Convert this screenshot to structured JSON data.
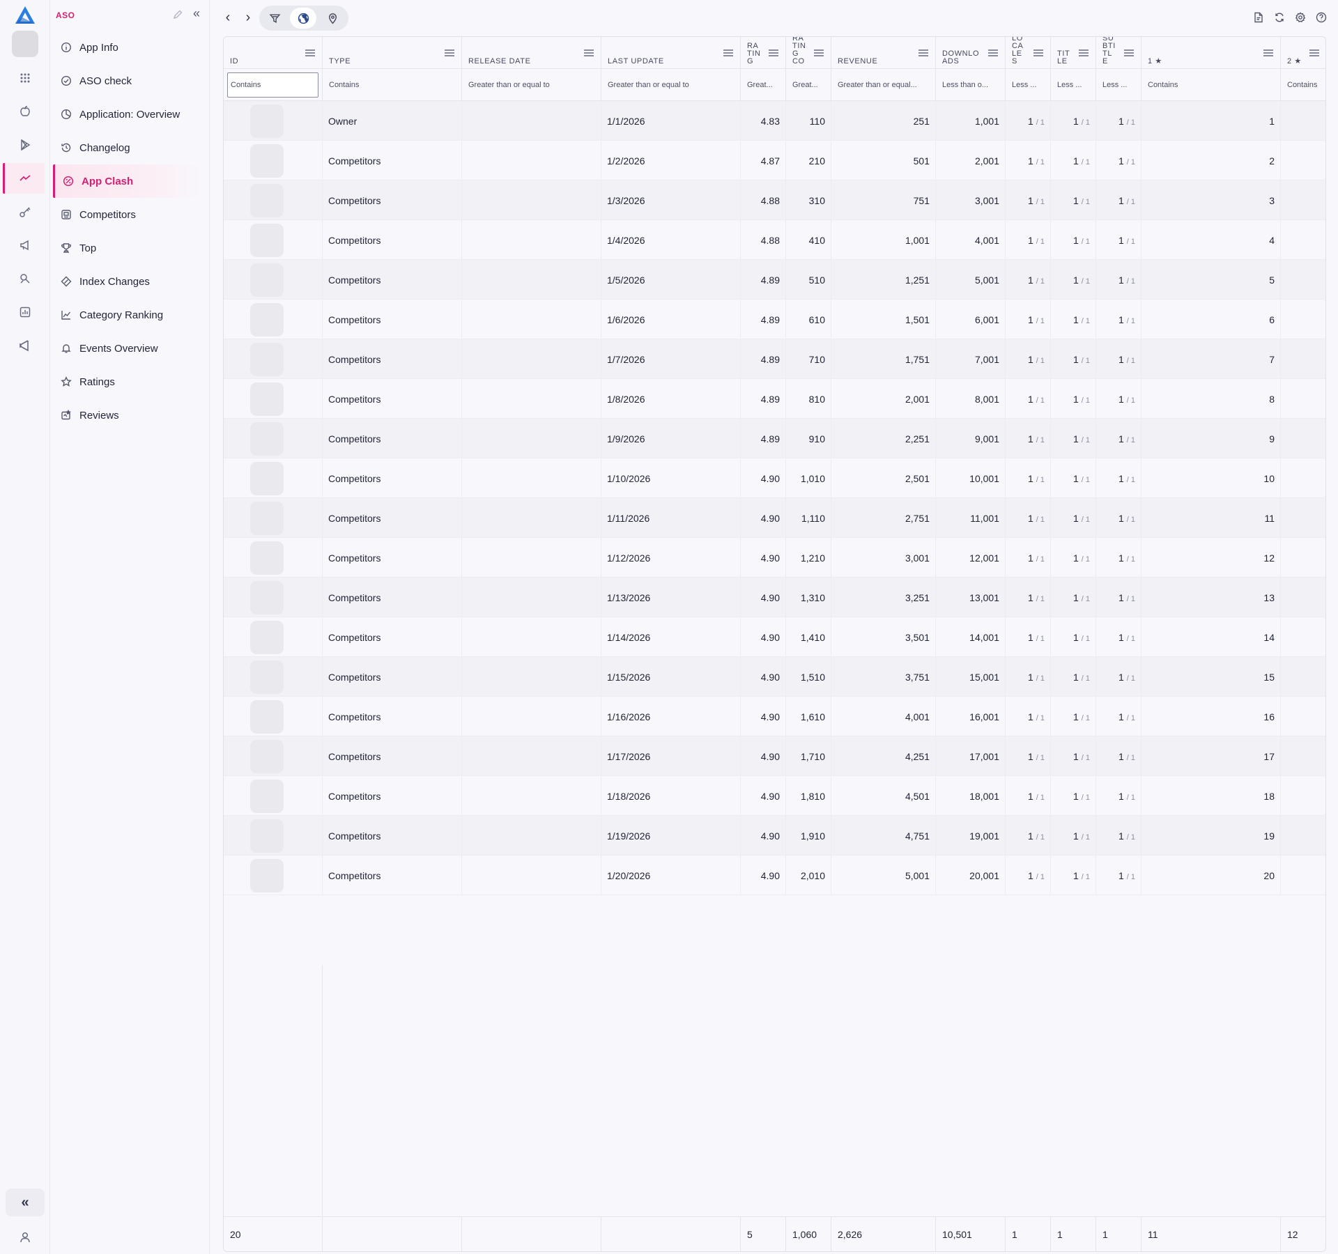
{
  "app": {
    "section_title": "ASO",
    "brand_color": "#d81e73"
  },
  "nav": [
    {
      "key": "app-info",
      "label": "App Info",
      "icon": "info-circle-icon"
    },
    {
      "key": "aso-check",
      "label": "ASO check",
      "icon": "check-circle-icon"
    },
    {
      "key": "application-overview",
      "label": "Application: Overview",
      "icon": "pie-chart-icon"
    },
    {
      "key": "changelog",
      "label": "Changelog",
      "icon": "history-icon"
    },
    {
      "key": "app-clash",
      "label": "App Clash",
      "icon": "clash-icon",
      "active": true
    },
    {
      "key": "competitors",
      "label": "Competitors",
      "icon": "competitors-icon"
    },
    {
      "key": "top",
      "label": "Top",
      "icon": "trophy-icon"
    },
    {
      "key": "index-changes",
      "label": "Index Changes",
      "icon": "index-icon"
    },
    {
      "key": "category-ranking",
      "label": "Category Ranking",
      "icon": "line-chart-icon"
    },
    {
      "key": "events-overview",
      "label": "Events Overview",
      "icon": "bell-icon"
    },
    {
      "key": "ratings",
      "label": "Ratings",
      "icon": "star-icon"
    },
    {
      "key": "reviews",
      "label": "Reviews",
      "icon": "reviews-icon"
    }
  ],
  "grid": {
    "columns": [
      {
        "key": "id",
        "header": "ID",
        "filter": "Contains"
      },
      {
        "key": "type",
        "header": "TYPE",
        "filter": "Contains"
      },
      {
        "key": "release_date",
        "header": "RELEASE DATE",
        "filter": "Greater than or equal to"
      },
      {
        "key": "last_update",
        "header": "LAST UPDATE",
        "filter": "Greater than or equal to"
      },
      {
        "key": "rating",
        "header": "RA\nTIN\nG",
        "filter": "Great..."
      },
      {
        "key": "rating_count",
        "header": "RA\nTIN\nG\nCO",
        "filter": "Great..."
      },
      {
        "key": "revenue",
        "header": "REVENUE",
        "filter": "Greater than or equal..."
      },
      {
        "key": "downloads",
        "header": "DOWNLO\nADS",
        "filter": "Less than o..."
      },
      {
        "key": "locale",
        "header": "LO\nCA\nLE\nS",
        "filter": "Less ..."
      },
      {
        "key": "title",
        "header": "TIT\nLE",
        "filter": "Less ..."
      },
      {
        "key": "subtitle",
        "header": "SU\nBTI\nTL\nE",
        "filter": "Less ..."
      },
      {
        "key": "star1",
        "header": "1 ★",
        "filter": "Contains"
      },
      {
        "key": "star2",
        "header": "2 ★",
        "filter": "Contains"
      }
    ],
    "rows": [
      {
        "type": "Owner",
        "release_date": "",
        "last_update": "1/1/2026",
        "rating": "4.83",
        "rating_count": "110",
        "revenue": "251",
        "downloads": "1,001",
        "locale": [
          "1",
          "/ 1"
        ],
        "title": [
          "1",
          "/ 1"
        ],
        "subtitle": [
          "1",
          "/ 1"
        ],
        "star1": "1",
        "star2": ""
      },
      {
        "type": "Competitors",
        "release_date": "",
        "last_update": "1/2/2026",
        "rating": "4.87",
        "rating_count": "210",
        "revenue": "501",
        "downloads": "2,001",
        "locale": [
          "1",
          "/ 1"
        ],
        "title": [
          "1",
          "/ 1"
        ],
        "subtitle": [
          "1",
          "/ 1"
        ],
        "star1": "2",
        "star2": ""
      },
      {
        "type": "Competitors",
        "release_date": "",
        "last_update": "1/3/2026",
        "rating": "4.88",
        "rating_count": "310",
        "revenue": "751",
        "downloads": "3,001",
        "locale": [
          "1",
          "/ 1"
        ],
        "title": [
          "1",
          "/ 1"
        ],
        "subtitle": [
          "1",
          "/ 1"
        ],
        "star1": "3",
        "star2": ""
      },
      {
        "type": "Competitors",
        "release_date": "",
        "last_update": "1/4/2026",
        "rating": "4.88",
        "rating_count": "410",
        "revenue": "1,001",
        "downloads": "4,001",
        "locale": [
          "1",
          "/ 1"
        ],
        "title": [
          "1",
          "/ 1"
        ],
        "subtitle": [
          "1",
          "/ 1"
        ],
        "star1": "4",
        "star2": ""
      },
      {
        "type": "Competitors",
        "release_date": "",
        "last_update": "1/5/2026",
        "rating": "4.89",
        "rating_count": "510",
        "revenue": "1,251",
        "downloads": "5,001",
        "locale": [
          "1",
          "/ 1"
        ],
        "title": [
          "1",
          "/ 1"
        ],
        "subtitle": [
          "1",
          "/ 1"
        ],
        "star1": "5",
        "star2": ""
      },
      {
        "type": "Competitors",
        "release_date": "",
        "last_update": "1/6/2026",
        "rating": "4.89",
        "rating_count": "610",
        "revenue": "1,501",
        "downloads": "6,001",
        "locale": [
          "1",
          "/ 1"
        ],
        "title": [
          "1",
          "/ 1"
        ],
        "subtitle": [
          "1",
          "/ 1"
        ],
        "star1": "6",
        "star2": ""
      },
      {
        "type": "Competitors",
        "release_date": "",
        "last_update": "1/7/2026",
        "rating": "4.89",
        "rating_count": "710",
        "revenue": "1,751",
        "downloads": "7,001",
        "locale": [
          "1",
          "/ 1"
        ],
        "title": [
          "1",
          "/ 1"
        ],
        "subtitle": [
          "1",
          "/ 1"
        ],
        "star1": "7",
        "star2": ""
      },
      {
        "type": "Competitors",
        "release_date": "",
        "last_update": "1/8/2026",
        "rating": "4.89",
        "rating_count": "810",
        "revenue": "2,001",
        "downloads": "8,001",
        "locale": [
          "1",
          "/ 1"
        ],
        "title": [
          "1",
          "/ 1"
        ],
        "subtitle": [
          "1",
          "/ 1"
        ],
        "star1": "8",
        "star2": ""
      },
      {
        "type": "Competitors",
        "release_date": "",
        "last_update": "1/9/2026",
        "rating": "4.89",
        "rating_count": "910",
        "revenue": "2,251",
        "downloads": "9,001",
        "locale": [
          "1",
          "/ 1"
        ],
        "title": [
          "1",
          "/ 1"
        ],
        "subtitle": [
          "1",
          "/ 1"
        ],
        "star1": "9",
        "star2": ""
      },
      {
        "type": "Competitors",
        "release_date": "",
        "last_update": "1/10/2026",
        "rating": "4.90",
        "rating_count": "1,010",
        "revenue": "2,501",
        "downloads": "10,001",
        "locale": [
          "1",
          "/ 1"
        ],
        "title": [
          "1",
          "/ 1"
        ],
        "subtitle": [
          "1",
          "/ 1"
        ],
        "star1": "10",
        "star2": ""
      },
      {
        "type": "Competitors",
        "release_date": "",
        "last_update": "1/11/2026",
        "rating": "4.90",
        "rating_count": "1,110",
        "revenue": "2,751",
        "downloads": "11,001",
        "locale": [
          "1",
          "/ 1"
        ],
        "title": [
          "1",
          "/ 1"
        ],
        "subtitle": [
          "1",
          "/ 1"
        ],
        "star1": "11",
        "star2": ""
      },
      {
        "type": "Competitors",
        "release_date": "",
        "last_update": "1/12/2026",
        "rating": "4.90",
        "rating_count": "1,210",
        "revenue": "3,001",
        "downloads": "12,001",
        "locale": [
          "1",
          "/ 1"
        ],
        "title": [
          "1",
          "/ 1"
        ],
        "subtitle": [
          "1",
          "/ 1"
        ],
        "star1": "12",
        "star2": ""
      },
      {
        "type": "Competitors",
        "release_date": "",
        "last_update": "1/13/2026",
        "rating": "4.90",
        "rating_count": "1,310",
        "revenue": "3,251",
        "downloads": "13,001",
        "locale": [
          "1",
          "/ 1"
        ],
        "title": [
          "1",
          "/ 1"
        ],
        "subtitle": [
          "1",
          "/ 1"
        ],
        "star1": "13",
        "star2": ""
      },
      {
        "type": "Competitors",
        "release_date": "",
        "last_update": "1/14/2026",
        "rating": "4.90",
        "rating_count": "1,410",
        "revenue": "3,501",
        "downloads": "14,001",
        "locale": [
          "1",
          "/ 1"
        ],
        "title": [
          "1",
          "/ 1"
        ],
        "subtitle": [
          "1",
          "/ 1"
        ],
        "star1": "14",
        "star2": ""
      },
      {
        "type": "Competitors",
        "release_date": "",
        "last_update": "1/15/2026",
        "rating": "4.90",
        "rating_count": "1,510",
        "revenue": "3,751",
        "downloads": "15,001",
        "locale": [
          "1",
          "/ 1"
        ],
        "title": [
          "1",
          "/ 1"
        ],
        "subtitle": [
          "1",
          "/ 1"
        ],
        "star1": "15",
        "star2": ""
      },
      {
        "type": "Competitors",
        "release_date": "",
        "last_update": "1/16/2026",
        "rating": "4.90",
        "rating_count": "1,610",
        "revenue": "4,001",
        "downloads": "16,001",
        "locale": [
          "1",
          "/ 1"
        ],
        "title": [
          "1",
          "/ 1"
        ],
        "subtitle": [
          "1",
          "/ 1"
        ],
        "star1": "16",
        "star2": ""
      },
      {
        "type": "Competitors",
        "release_date": "",
        "last_update": "1/17/2026",
        "rating": "4.90",
        "rating_count": "1,710",
        "revenue": "4,251",
        "downloads": "17,001",
        "locale": [
          "1",
          "/ 1"
        ],
        "title": [
          "1",
          "/ 1"
        ],
        "subtitle": [
          "1",
          "/ 1"
        ],
        "star1": "17",
        "star2": ""
      },
      {
        "type": "Competitors",
        "release_date": "",
        "last_update": "1/18/2026",
        "rating": "4.90",
        "rating_count": "1,810",
        "revenue": "4,501",
        "downloads": "18,001",
        "locale": [
          "1",
          "/ 1"
        ],
        "title": [
          "1",
          "/ 1"
        ],
        "subtitle": [
          "1",
          "/ 1"
        ],
        "star1": "18",
        "star2": ""
      },
      {
        "type": "Competitors",
        "release_date": "",
        "last_update": "1/19/2026",
        "rating": "4.90",
        "rating_count": "1,910",
        "revenue": "4,751",
        "downloads": "19,001",
        "locale": [
          "1",
          "/ 1"
        ],
        "title": [
          "1",
          "/ 1"
        ],
        "subtitle": [
          "1",
          "/ 1"
        ],
        "star1": "19",
        "star2": ""
      },
      {
        "type": "Competitors",
        "release_date": "",
        "last_update": "1/20/2026",
        "rating": "4.90",
        "rating_count": "2,010",
        "revenue": "5,001",
        "downloads": "20,001",
        "locale": [
          "1",
          "/ 1"
        ],
        "title": [
          "1",
          "/ 1"
        ],
        "subtitle": [
          "1",
          "/ 1"
        ],
        "star1": "20",
        "star2": ""
      }
    ],
    "footer": {
      "id": "20",
      "type": "",
      "release_date": "",
      "last_update": "",
      "rating": "5",
      "rating_count": "1,060",
      "revenue": "2,626",
      "downloads": "10,501",
      "locale": "1",
      "title": "1",
      "subtitle": "1",
      "star1": "11",
      "star2": "12"
    }
  }
}
